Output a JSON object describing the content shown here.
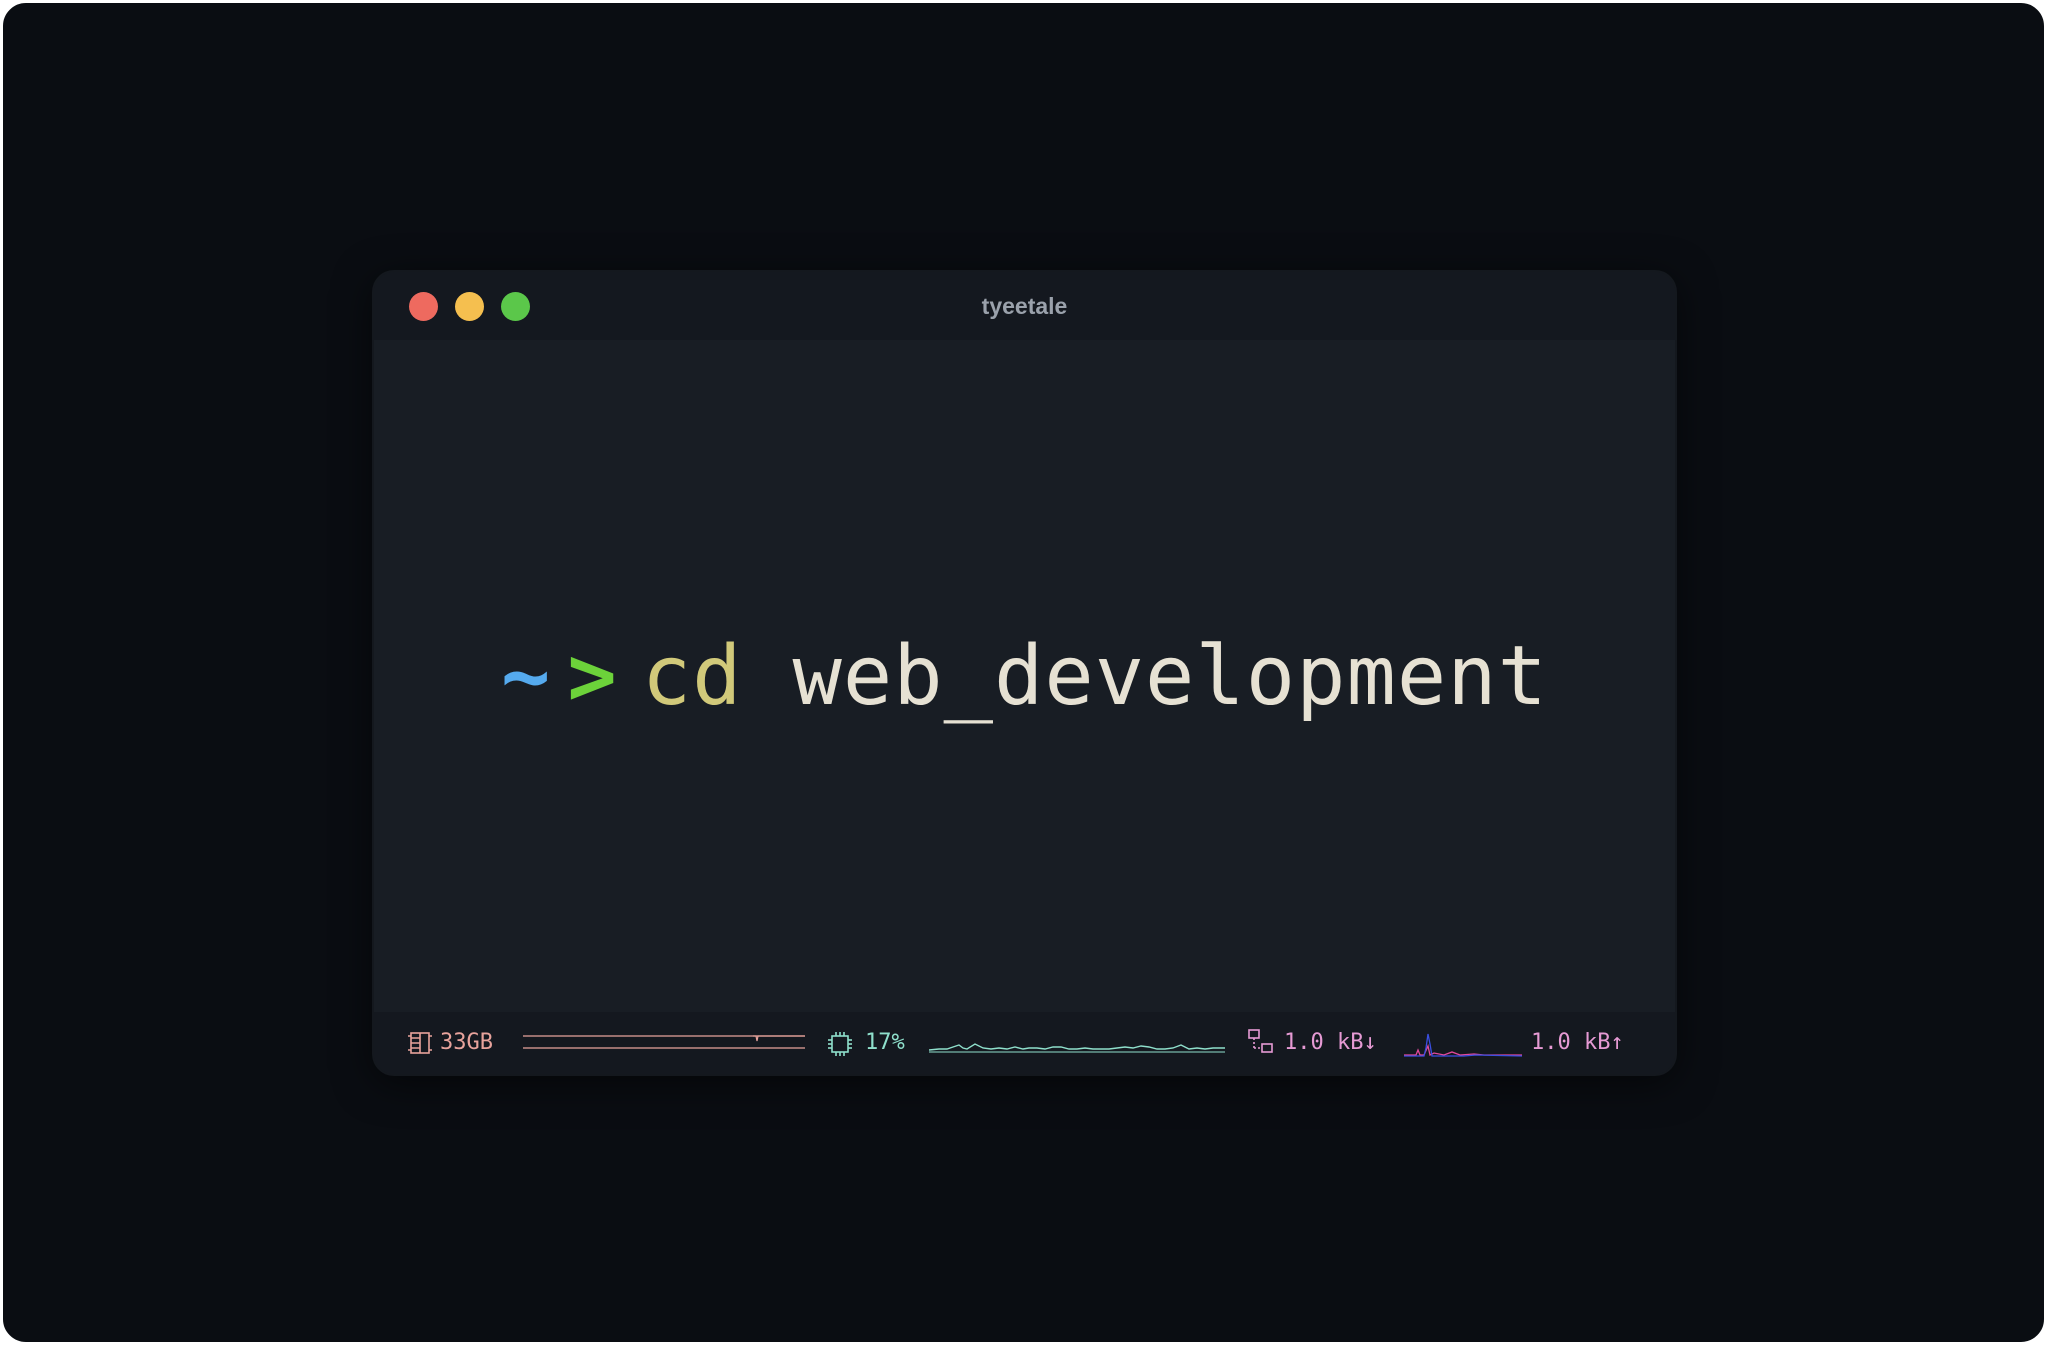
{
  "window": {
    "title": "tyeetale",
    "controls": {
      "close_color": "#ee6a5f",
      "minimize_color": "#f5bf4f",
      "maximize_color": "#5bc74a"
    }
  },
  "terminal": {
    "prompt_home": "~",
    "prompt_arrow": ">",
    "command": "cd",
    "argument": "web_development"
  },
  "statusbar": {
    "memory": {
      "icon": "memory-icon",
      "value": "33GB",
      "color": "#e8a39c"
    },
    "cpu": {
      "icon": "cpu-icon",
      "value": "17%",
      "color": "#8fe0cc"
    },
    "network_down": {
      "icon": "network-icon",
      "value": "1.0 kB↓",
      "color": "#e69ad4"
    },
    "network_up": {
      "value": "1.0 kB↑",
      "color": "#e69ad4"
    }
  },
  "colors": {
    "backdrop": "#0a0d12",
    "window_body": "#181d24",
    "titlebar": "#14181f",
    "tilde": "#55aaee",
    "arrow": "#6cd23a",
    "command": "#d1c97a",
    "argument": "#e6e1d3"
  }
}
